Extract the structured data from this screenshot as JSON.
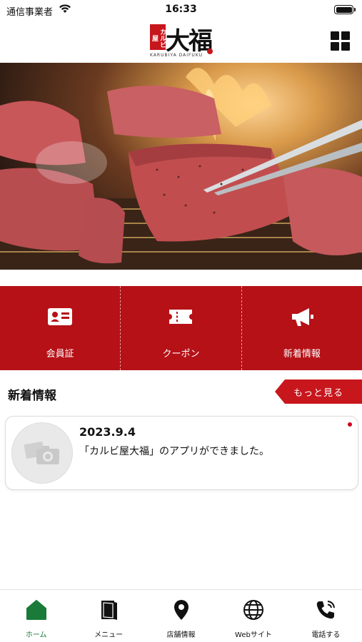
{
  "status_bar": {
    "carrier": "通信事業者",
    "time": "16:33"
  },
  "header": {
    "logo_red_text": "カルビ屋",
    "logo_main_text": "大福",
    "logo_sub_text": "KARUBIYA DAIFUKU"
  },
  "features": [
    {
      "label": "会員証",
      "icon": "member-card-icon"
    },
    {
      "label": "クーポン",
      "icon": "coupon-ticket-icon"
    },
    {
      "label": "新着情報",
      "icon": "megaphone-icon"
    }
  ],
  "news": {
    "section_title": "新着情報",
    "more_label": "もっと見る",
    "items": [
      {
        "date": "2023.9.4",
        "text": "「カルビ屋大福」のアプリができました。",
        "unread": true
      }
    ]
  },
  "tab_bar": {
    "tabs": [
      {
        "label": "ホーム",
        "icon": "home-icon",
        "active": true
      },
      {
        "label": "メニュー",
        "icon": "menu-book-icon",
        "active": false
      },
      {
        "label": "店舗情報",
        "icon": "map-pin-icon",
        "active": false
      },
      {
        "label": "Webサイト",
        "icon": "globe-icon",
        "active": false
      },
      {
        "label": "電話する",
        "icon": "phone-icon",
        "active": false
      }
    ]
  },
  "colors": {
    "brand_red": "#b51117",
    "active_tab": "#1a7a3a"
  }
}
